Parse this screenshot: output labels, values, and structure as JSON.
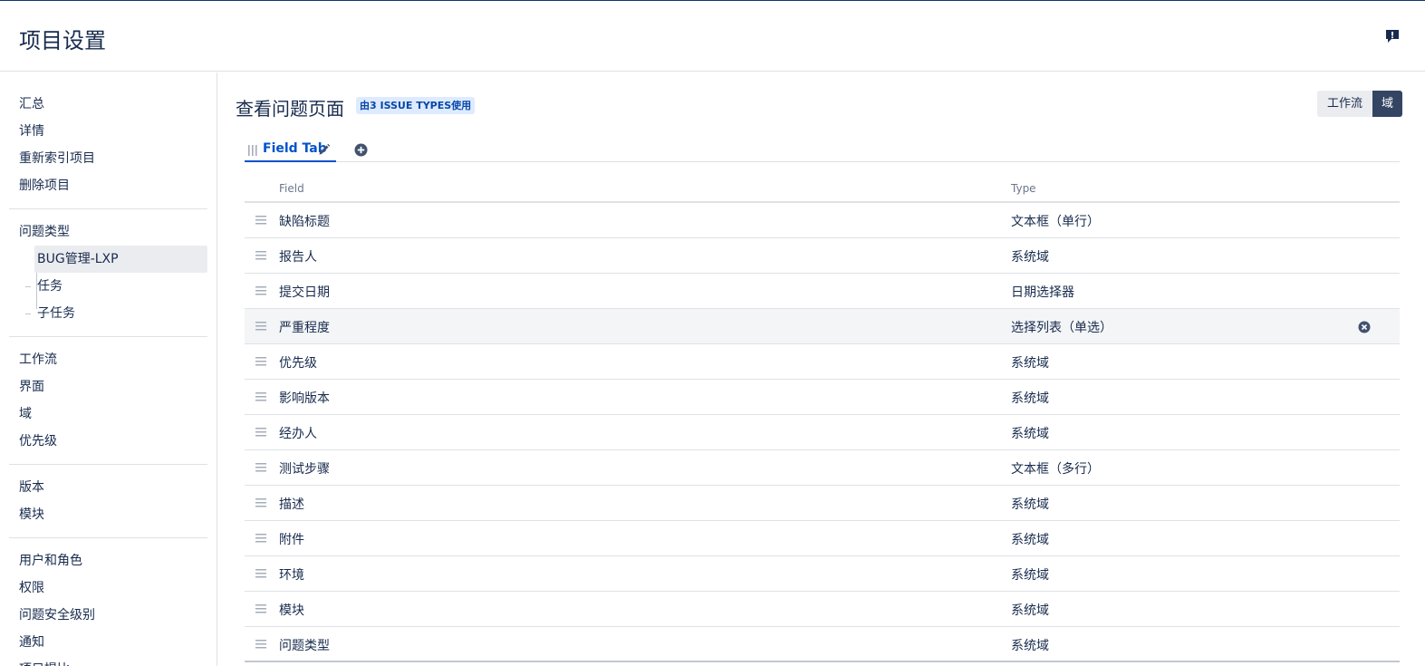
{
  "header": {
    "title": "项目设置",
    "feedback_icon": "feedback-icon"
  },
  "sidebar": {
    "group1": [
      "汇总",
      "详情",
      "重新索引项目",
      "删除项目"
    ],
    "issue_types_label": "问题类型",
    "issue_types": [
      "BUG管理-LXP",
      "任务",
      "子任务"
    ],
    "group3": [
      "工作流",
      "界面",
      "域",
      "优先级"
    ],
    "group4": [
      "版本",
      "模块"
    ],
    "group5": [
      "用户和角色",
      "权限",
      "问题安全级别",
      "通知",
      "项目提比"
    ]
  },
  "main": {
    "title": "查看问题页面",
    "lozenge": "由3 ISSUE TYPES使用",
    "buttons": {
      "workflow": "工作流",
      "fields": "域"
    },
    "tab": {
      "label": "Field Tab"
    },
    "table": {
      "headers": {
        "field": "Field",
        "type": "Type"
      },
      "rows": [
        {
          "field": "缺陷标题",
          "type": "文本框（单行）"
        },
        {
          "field": "报告人",
          "type": "系统域"
        },
        {
          "field": "提交日期",
          "type": "日期选择器"
        },
        {
          "field": "严重程度",
          "type": "选择列表（单选）"
        },
        {
          "field": "优先级",
          "type": "系统域"
        },
        {
          "field": "影响版本",
          "type": "系统域"
        },
        {
          "field": "经办人",
          "type": "系统域"
        },
        {
          "field": "测试步骤",
          "type": "文本框（多行）"
        },
        {
          "field": "描述",
          "type": "系统域"
        },
        {
          "field": "附件",
          "type": "系统域"
        },
        {
          "field": "环境",
          "type": "系统域"
        },
        {
          "field": "模块",
          "type": "系统域"
        },
        {
          "field": "问题类型",
          "type": "系统域"
        }
      ]
    }
  },
  "colors": {
    "accent": "#0052cc",
    "dark_button": "#344563",
    "lozenge_bg": "#deebff"
  }
}
